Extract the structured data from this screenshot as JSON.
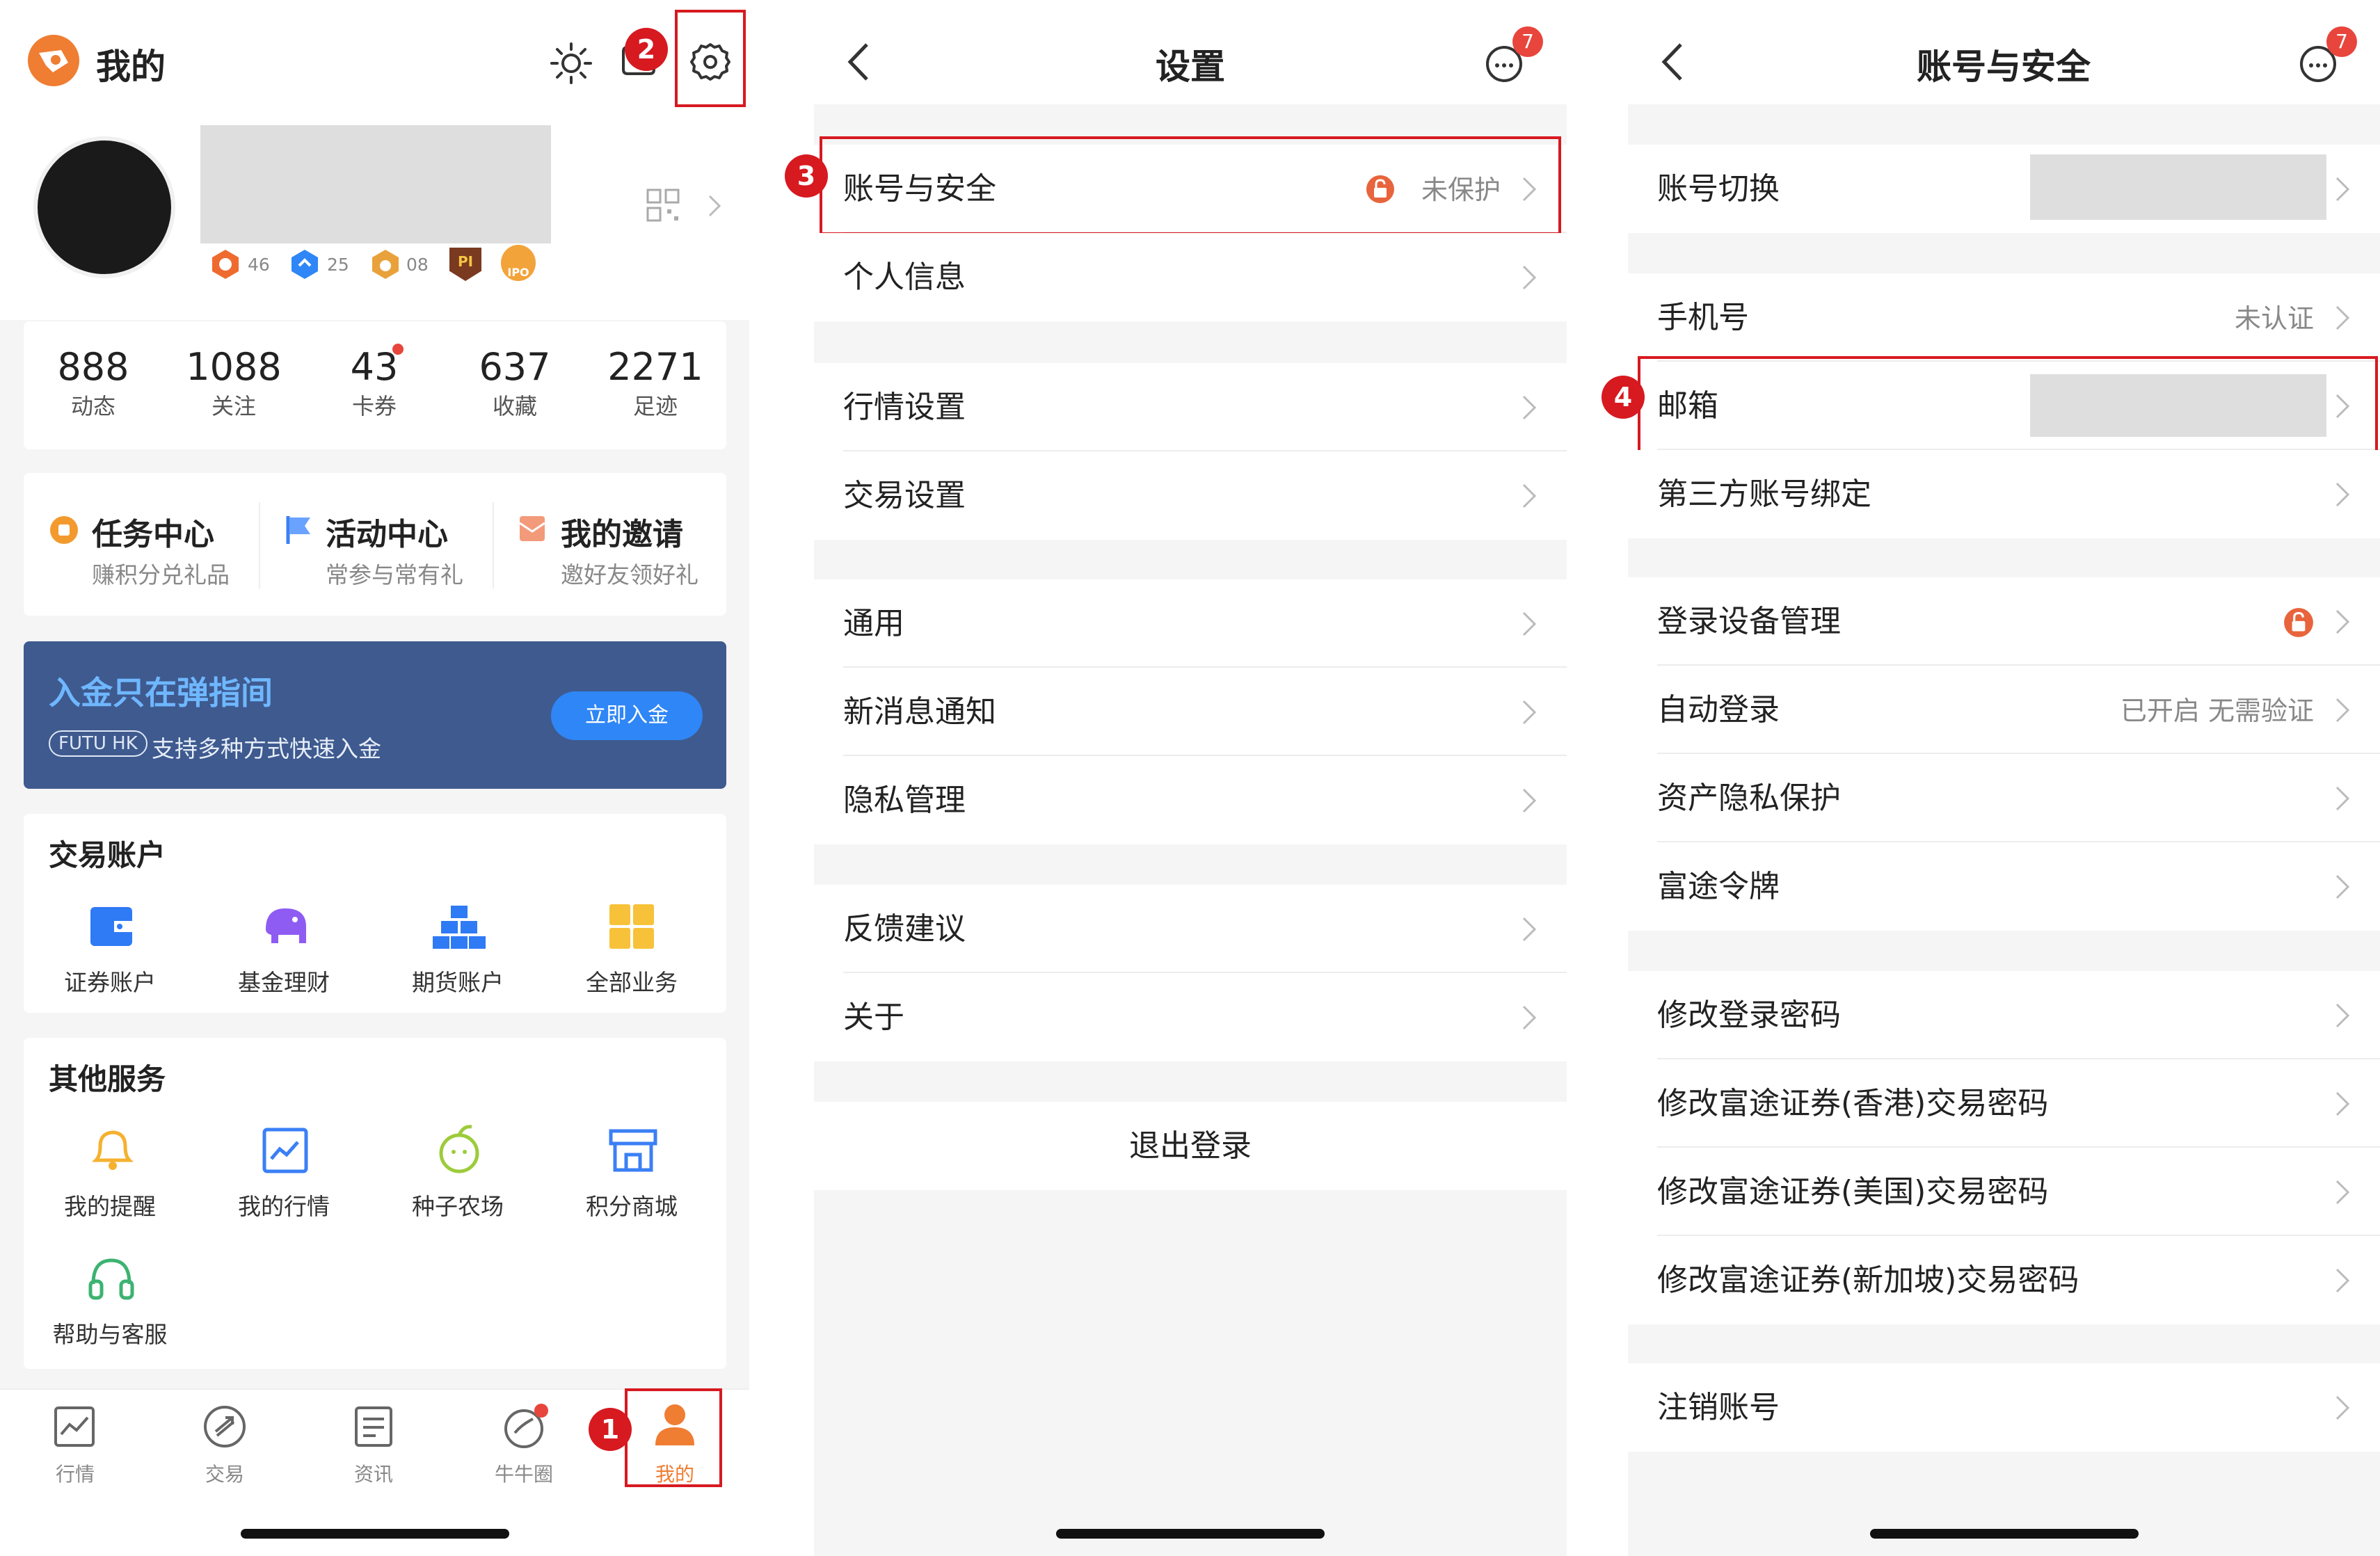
{
  "panel1": {
    "title": "我的",
    "badges": [
      "46",
      "25",
      "08"
    ],
    "badge_tags": [
      "PI",
      "IPO"
    ],
    "stats": [
      {
        "num": "888",
        "label": "动态"
      },
      {
        "num": "1088",
        "label": "关注"
      },
      {
        "num": "43",
        "label": "卡券"
      },
      {
        "num": "637",
        "label": "收藏"
      },
      {
        "num": "2271",
        "label": "足迹"
      }
    ],
    "centers": [
      {
        "title": "任务中心",
        "sub": "赚积分兑礼品"
      },
      {
        "title": "活动中心",
        "sub": "常参与常有礼"
      },
      {
        "title": "我的邀请",
        "sub": "邀好友领好礼"
      }
    ],
    "banner": {
      "title": "入金只在弹指间",
      "tag": "FUTU HK",
      "sub": "支持多种方式快速入金",
      "button": "立即入金"
    },
    "trade_section": {
      "title": "交易账户",
      "items": [
        "证券账户",
        "基金理财",
        "期货账户",
        "全部业务"
      ]
    },
    "other_section": {
      "title": "其他服务",
      "items": [
        "我的提醒",
        "我的行情",
        "种子农场",
        "积分商城",
        "帮助与客服"
      ]
    },
    "tabs": [
      "行情",
      "交易",
      "资讯",
      "牛牛圈",
      "我的"
    ],
    "step_labels": [
      "1",
      "2"
    ]
  },
  "panel2": {
    "title": "设置",
    "msg_count": "7",
    "rows": [
      {
        "label": "账号与安全",
        "value": "未保护"
      },
      {
        "label": "个人信息",
        "value": ""
      },
      {
        "label": "行情设置",
        "value": ""
      },
      {
        "label": "交易设置",
        "value": ""
      },
      {
        "label": "通用",
        "value": ""
      },
      {
        "label": "新消息通知",
        "value": ""
      },
      {
        "label": "隐私管理",
        "value": ""
      },
      {
        "label": "反馈建议",
        "value": ""
      },
      {
        "label": "关于",
        "value": ""
      }
    ],
    "logout": "退出登录",
    "step_label": "3"
  },
  "panel3": {
    "title": "账号与安全",
    "msg_count": "7",
    "rows": [
      {
        "label": "账号切换",
        "value": ""
      },
      {
        "label": "手机号",
        "value": "未认证"
      },
      {
        "label": "邮箱",
        "value": ""
      },
      {
        "label": "第三方账号绑定",
        "value": ""
      },
      {
        "label": "登录设备管理",
        "value": ""
      },
      {
        "label": "自动登录",
        "value": "已开启 无需验证"
      },
      {
        "label": "资产隐私保护",
        "value": ""
      },
      {
        "label": "富途令牌",
        "value": ""
      },
      {
        "label": "修改登录密码",
        "value": ""
      },
      {
        "label": "修改富途证券(香港)交易密码",
        "value": ""
      },
      {
        "label": "修改富途证券(美国)交易密码",
        "value": ""
      },
      {
        "label": "修改富途证券(新加坡)交易密码",
        "value": ""
      },
      {
        "label": "注销账号",
        "value": ""
      }
    ],
    "step_label": "4"
  },
  "colors": {
    "brand_orange": "#ef7d32",
    "highlight_red": "#d71920",
    "banner_blue": "#3e5a8f",
    "link_blue": "#2f86f6"
  }
}
